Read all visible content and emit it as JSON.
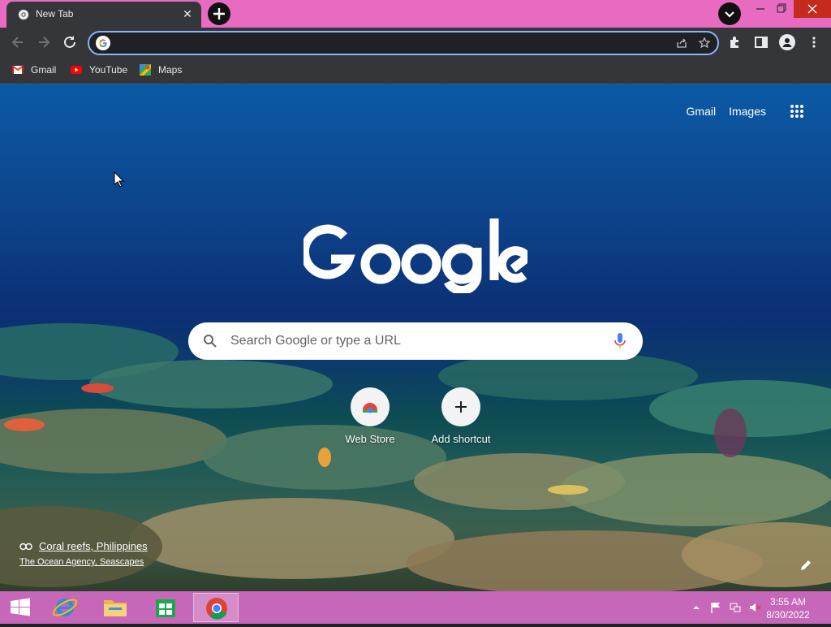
{
  "tab": {
    "title": "New Tab"
  },
  "omnibox": {
    "value": "",
    "placeholder": ""
  },
  "bookmarks": [
    {
      "label": "Gmail"
    },
    {
      "label": "YouTube"
    },
    {
      "label": "Maps"
    }
  ],
  "ntp": {
    "links": {
      "gmail": "Gmail",
      "images": "Images"
    },
    "search_placeholder": "Search Google or type a URL",
    "shortcuts": [
      {
        "label": "Web Store"
      },
      {
        "label": "Add shortcut"
      }
    ],
    "attribution": {
      "title": "Coral reefs, Philippines",
      "credit": "The Ocean Agency, Seascapes"
    }
  },
  "taskbar": {
    "time": "3:55 AM",
    "date": "8/30/2022"
  },
  "colors": {
    "tab_strip": "#e96bc1",
    "toolbar": "#35363a",
    "omnibox_focus": "#8ab4f8",
    "taskbar": "#c767b9",
    "close_button": "#c42b1c"
  }
}
